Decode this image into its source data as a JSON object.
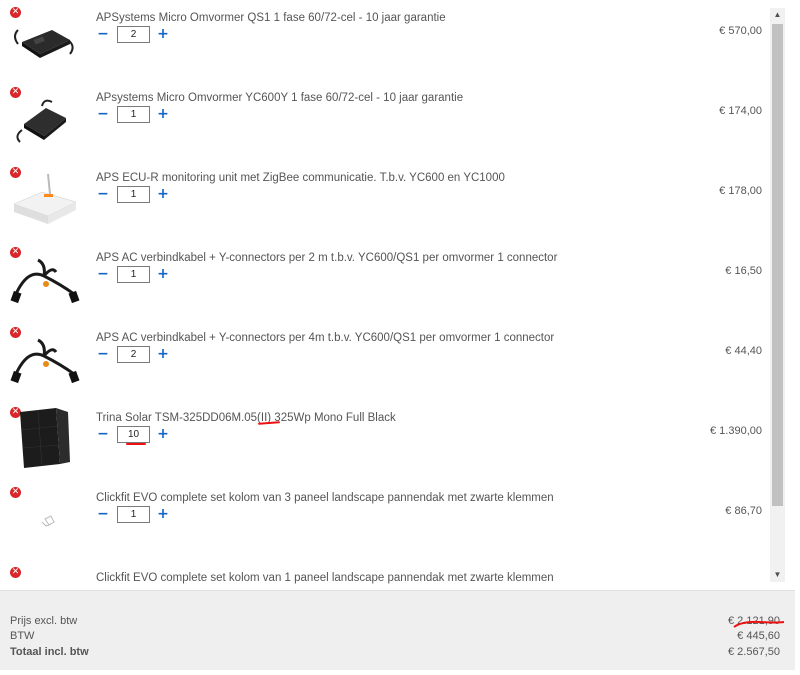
{
  "cart": {
    "remove_symbol": "✕",
    "minus_symbol": "−",
    "plus_symbol": "+",
    "items": [
      {
        "title": "APSystems Micro Omvormer QS1 1 fase 60/72-cel - 10 jaar garantie",
        "qty": "2",
        "price": "€ 570,00",
        "image": "microinverter-qs1"
      },
      {
        "title": "APsystems Micro Omvormer YC600Y 1 fase 60/72-cel - 10 jaar garantie",
        "qty": "1",
        "price": "€ 174,00",
        "image": "microinverter-yc600"
      },
      {
        "title": "APS ECU-R monitoring unit met ZigBee communicatie. T.b.v. YC600 en YC1000",
        "qty": "1",
        "price": "€ 178,00",
        "image": "ecu-router"
      },
      {
        "title": "APS AC verbindkabel + Y-connectors per 2 m t.b.v. YC600/QS1 per omvormer 1 connector",
        "qty": "1",
        "price": "€ 16,50",
        "image": "y-connector-cable"
      },
      {
        "title": "APS AC verbindkabel + Y-connectors per 4m t.b.v. YC600/QS1 per omvormer 1 connector",
        "qty": "2",
        "price": "€ 44,40",
        "image": "y-connector-cable"
      },
      {
        "title": "Trina Solar TSM-325DD06M.05(II) 325Wp Mono Full Black",
        "qty": "10",
        "price": "€ 1.390,00",
        "image": "solar-panel"
      },
      {
        "title": "Clickfit EVO complete set kolom van 3 paneel landscape pannendak met zwarte klemmen",
        "qty": "1",
        "price": "€ 86,70",
        "image": "broken-image"
      },
      {
        "title": "Clickfit EVO complete set kolom van 1 paneel landscape pannendak met zwarte klemmen",
        "qty": "",
        "price": "",
        "image": "broken-image"
      }
    ]
  },
  "totals": {
    "subtotal_label": "Prijs excl. btw",
    "subtotal_value": "€ 2.121,90",
    "vat_label": "BTW",
    "vat_value": "€ 445,60",
    "total_label": "Totaal incl. btw",
    "total_value": "€ 2.567,50"
  },
  "colors": {
    "remove": "#d8262b",
    "stepper": "#1565c0",
    "annotation": "#e11111",
    "totals_bg": "#efefef"
  }
}
